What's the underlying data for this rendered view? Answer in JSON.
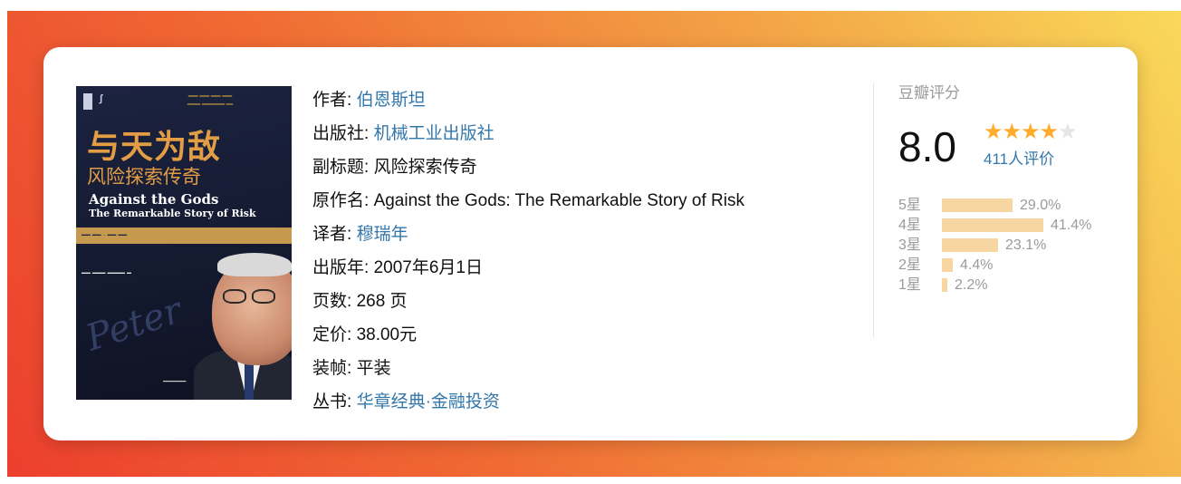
{
  "book": {
    "cover": {
      "title_cn": "与天为敌",
      "subtitle_cn": "风险探索传奇",
      "title_en": "Against the Gods",
      "subtitle_en": "The Remarkable Story of Risk"
    },
    "details": [
      {
        "label": "作者: ",
        "value": "伯恩斯坦",
        "link": true
      },
      {
        "label": "出版社: ",
        "value": "机械工业出版社",
        "link": true
      },
      {
        "label": "副标题: ",
        "value": "风险探索传奇",
        "link": false
      },
      {
        "label": "原作名: ",
        "value": "Against the Gods: The Remarkable Story of Risk",
        "link": false
      },
      {
        "label": "译者: ",
        "value": "穆瑞年",
        "link": true
      },
      {
        "label": "出版年: ",
        "value": "2007年6月1日",
        "link": false
      },
      {
        "label": "页数: ",
        "value": "268 页",
        "link": false
      },
      {
        "label": "定价: ",
        "value": "38.00元",
        "link": false
      },
      {
        "label": "装帧: ",
        "value": "平装",
        "link": false
      },
      {
        "label": "丛书: ",
        "value": "华章经典·金融投资",
        "link": true
      }
    ]
  },
  "rating": {
    "label": "豆瓣评分",
    "score": "8.0",
    "stars_filled": 4,
    "stars_total": 5,
    "count_text": "411人评价",
    "distribution": [
      {
        "label": "5星",
        "percent": 29.0,
        "text": "29.0%"
      },
      {
        "label": "4星",
        "percent": 41.4,
        "text": "41.4%"
      },
      {
        "label": "3星",
        "percent": 23.1,
        "text": "23.1%"
      },
      {
        "label": "2星",
        "percent": 4.4,
        "text": "4.4%"
      },
      {
        "label": "1星",
        "percent": 2.2,
        "text": "2.2%"
      }
    ]
  },
  "colors": {
    "link": "#3377aa",
    "star": "#ffac2d",
    "bar": "#f7d6a1",
    "muted": "#9b9b9b"
  }
}
